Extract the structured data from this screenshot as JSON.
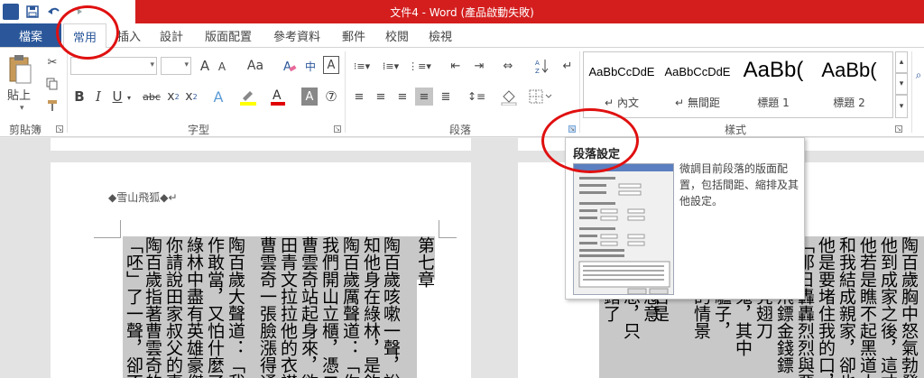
{
  "window": {
    "title": "文件4 - Word (產品啟動失敗)"
  },
  "quick_access": {
    "word_logo": "W",
    "icons": [
      "word-icon",
      "save-icon",
      "undo-icon",
      "redo-icon"
    ]
  },
  "tabs": {
    "file": "檔案",
    "items": [
      "常用",
      "插入",
      "設計",
      "版面配置",
      "參考資料",
      "郵件",
      "校閱",
      "檢視"
    ],
    "active": "常用"
  },
  "ribbon": {
    "groups": {
      "clipboard": "剪貼簿",
      "font": "字型",
      "paragraph": "段落",
      "styles": "樣式"
    },
    "clipboard": {
      "paste_label": "貼上"
    },
    "font": {
      "name_value": "",
      "size_value": "",
      "case_button": "Aa",
      "phonetic": "中",
      "bold": "B",
      "italic": "I",
      "underline": "U",
      "strikethrough": "abc",
      "subscript": "x",
      "superscript": "x",
      "grow": "A",
      "shrink": "A",
      "font_color": "A"
    },
    "styles": [
      {
        "sample": "AaBbCcDdE",
        "name": "內文",
        "mark": "↵"
      },
      {
        "sample": "AaBbCcDdE",
        "name": "無間距",
        "mark": "↵"
      },
      {
        "sample": "AaBb(",
        "name": "標題 1",
        "mark": ""
      },
      {
        "sample": "AaBb(",
        "name": "標題 2",
        "mark": ""
      }
    ]
  },
  "tooltip": {
    "title": "段落設定",
    "description": "微調目前段落的版面配置，包括間距、縮排及其他設定。"
  },
  "document": {
    "header": "◆雪山飛狐◆↵",
    "left_columns": [
      "第七章",
      "陶百歲咳嗽一聲，說道",
      "知他身在綠林，是欽馬川",
      "陶百歲厲聲道：「你聽不出我",
      "我們開山立櫃，憑二刀一",
      "曹雲奇站起身來，欲待還",
      "田青文拉拉他的衣襟，低",
      "曹雲奇一張臉漲得通紅",
      "陶百歲大聲道：「我陶百",
      "作敢當，又怕什麼了？」",
      "綠林中盡有英雄豪傑，誰",
      "你請說田家叔父的事吧",
      "陶百歲指著曹雲奇的鼻子",
      "「呸」了一聲，卻不答話"
    ],
    "right_columns": [
      "陶百歲胸中怒氣勃發，道",
      "他到成家之後，這才洗手",
      "他若是瞧不起黑道人物",
      "和我結成親家，卻也未必",
      "他是要堵住我的口，要我",
      "「那日轟轟烈烈與惡徒",
      "大軍中飛鏢金錢鏢",
      "用白鶴亮翅刀",
      "我膽小鬼，其中",
      "我沒留驢子，",
      "婦臨死的情景",
      "是說話。",
      "苗大俠若是",
      "胸心懷惡意",
      "都如此想，只",
      "說道：錯了"
    ]
  }
}
